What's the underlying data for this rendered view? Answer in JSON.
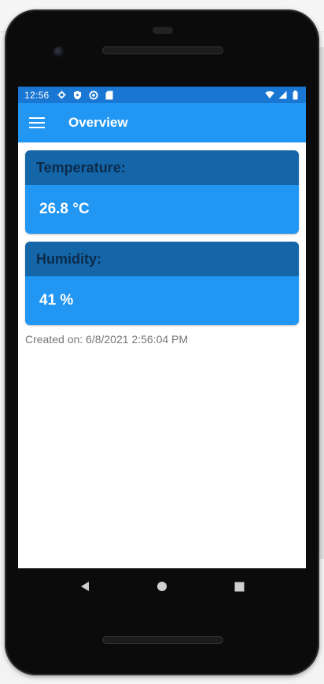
{
  "status_bar": {
    "time": "12:56",
    "left_icons": [
      "gear-icon",
      "shield-icon",
      "sync-icon",
      "sd-card-icon"
    ],
    "right_icons": [
      "wifi-icon",
      "signal-icon",
      "battery-icon"
    ]
  },
  "app_bar": {
    "title": "Overview",
    "menu_icon": "hamburger-icon"
  },
  "cards": [
    {
      "label": "Temperature:",
      "value": "26.8 °C"
    },
    {
      "label": "Humidity:",
      "value": "41 %"
    }
  ],
  "created_text": "Created on: 6/8/2021 2:56:04 PM",
  "nav_bar": {
    "buttons": [
      "back-icon",
      "home-icon",
      "recents-icon"
    ]
  },
  "colors": {
    "status_bar": "#1976d2",
    "app_bar": "#2196f3",
    "card_header": "#1466a8",
    "card_body": "#2196f3"
  }
}
